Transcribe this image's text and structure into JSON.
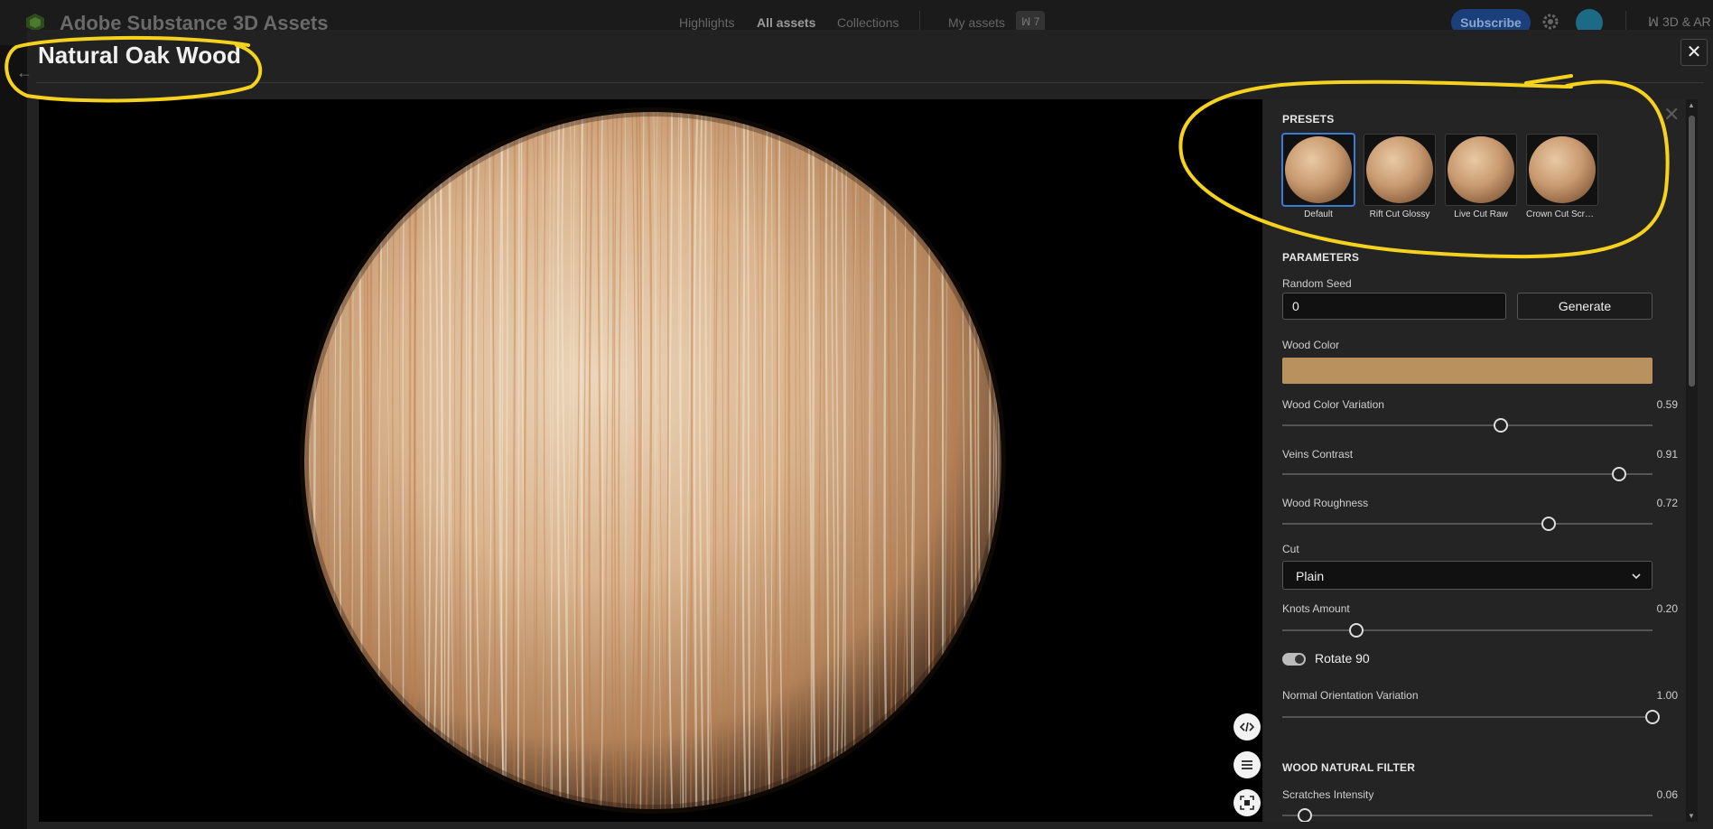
{
  "app": {
    "title": "Adobe Substance 3D Assets",
    "nav": [
      "Highlights",
      "All assets",
      "Collections",
      "My assets"
    ],
    "active_nav": "All assets",
    "badge": "7",
    "subscribe_label": "Subscribe",
    "brand_right": "3D & AR"
  },
  "modal": {
    "title": "Natural Oak Wood",
    "close_label": "✕"
  },
  "presets": {
    "heading": "PRESETS",
    "items": [
      {
        "label": "Default",
        "selected": true
      },
      {
        "label": "Rift Cut Glossy",
        "selected": false
      },
      {
        "label": "Live Cut Raw",
        "selected": false
      },
      {
        "label": "Crown Cut Scrat..."
      }
    ]
  },
  "parameters": {
    "heading": "PARAMETERS",
    "random_seed": {
      "label": "Random Seed",
      "value": "0",
      "button": "Generate"
    },
    "wood_color": {
      "label": "Wood Color",
      "color": "#b8915e"
    },
    "wood_color_variation": {
      "label": "Wood Color Variation",
      "value": "0.59",
      "level": 0.59
    },
    "veins_contrast": {
      "label": "Veins Contrast",
      "value": "0.91",
      "level": 0.91
    },
    "wood_roughness": {
      "label": "Wood Roughness",
      "value": "0.72",
      "level": 0.72
    },
    "cut": {
      "label": "Cut",
      "value": "Plain"
    },
    "knots_amount": {
      "label": "Knots Amount",
      "value": "0.20",
      "level": 0.2
    },
    "rotate_90": {
      "label": "Rotate 90",
      "on": true
    },
    "normal_orientation_variation": {
      "label": "Normal Orientation Variation",
      "value": "1.00",
      "level": 1.0
    }
  },
  "wood_natural_filter": {
    "heading": "WOOD NATURAL FILTER",
    "scratches_intensity": {
      "label": "Scratches Intensity",
      "value": "0.06",
      "level": 0.06
    }
  },
  "colors": {
    "accent": "#3b7bd4",
    "annotation": "#f5d21e"
  },
  "icons": [
    "close-icon",
    "code-icon",
    "menu-icon",
    "fit-view-icon",
    "chevron-down-icon",
    "gear-icon"
  ]
}
